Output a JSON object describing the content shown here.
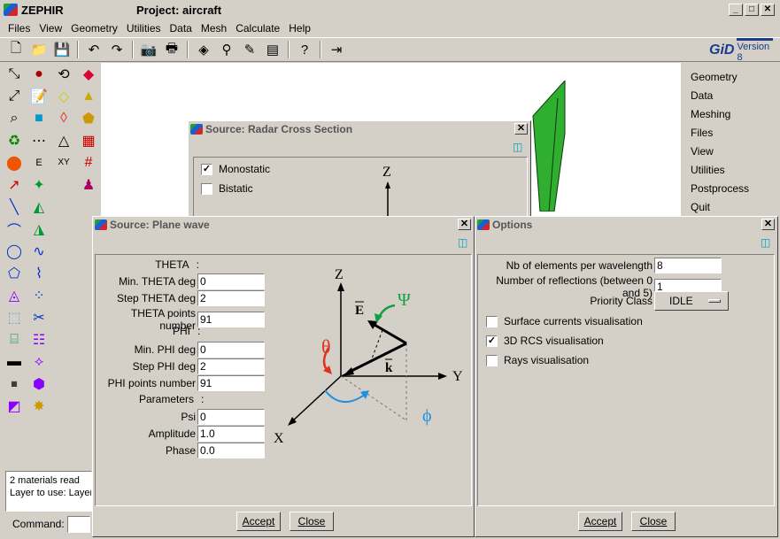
{
  "window": {
    "app_title": "ZEPHIR",
    "project_title": "Project: aircraft"
  },
  "menubar": [
    "Files",
    "View",
    "Geometry",
    "Utilities",
    "Data",
    "Mesh",
    "Calculate",
    "Help"
  ],
  "gid": {
    "logo": "GiD",
    "version": "Version 8"
  },
  "right_menu": [
    "Geometry",
    "Data",
    "Meshing",
    "Files",
    "View",
    "Utilities",
    "Postprocess",
    "Quit"
  ],
  "status": {
    "line1": "2 materials read",
    "line2": "Layer to use: Layer"
  },
  "command": {
    "label": "Command:",
    "value": ""
  },
  "rcs_dialog": {
    "title": "Source: Radar Cross Section",
    "monostatic_label": "Monostatic",
    "monostatic_checked": true,
    "bistatic_label": "Bistatic",
    "bistatic_checked": false,
    "axis_z": "Z"
  },
  "plane_wave_dialog": {
    "title": "Source: Plane wave",
    "theta_header": "THETA",
    "min_theta_label": "Min. THETA deg",
    "min_theta": "0",
    "step_theta_label": "Step THETA deg",
    "step_theta": "2",
    "theta_points_label": "THETA points number",
    "theta_points": "91",
    "phi_header": "PHI",
    "min_phi_label": "Min. PHI deg",
    "min_phi": "0",
    "step_phi_label": "Step PHI deg",
    "step_phi": "2",
    "phi_points_label": "PHI points number",
    "phi_points": "91",
    "params_header": "Parameters",
    "psi_label": "Psi",
    "psi": "0",
    "amplitude_label": "Amplitude",
    "amplitude": "1.0",
    "phase_label": "Phase",
    "phase": "0.0",
    "accept": "Accept",
    "close": "Close",
    "diagram": {
      "z": "Z",
      "y": "Y",
      "x": "X",
      "theta": "θ",
      "phi": "ϕ",
      "psi": "Ψ",
      "e": "E",
      "k": "k"
    }
  },
  "options_dialog": {
    "title": "Options",
    "nb_elements_label": "Nb of elements per wavelength",
    "nb_elements": "8",
    "reflections_label": "Number of reflections (between 0 and 5)",
    "reflections": "1",
    "priority_label": "Priority Class",
    "priority": "IDLE",
    "surface_currents_label": "Surface currents visualisation",
    "surface_currents_checked": false,
    "rcs_3d_label": "3D RCS visualisation",
    "rcs_3d_checked": true,
    "rays_label": "Rays visualisation",
    "rays_checked": false,
    "accept": "Accept",
    "close": "Close"
  },
  "colors": {
    "theta": "#e03020",
    "phi": "#2090e0",
    "psi": "#10a040",
    "wing": "#2fae2f"
  }
}
